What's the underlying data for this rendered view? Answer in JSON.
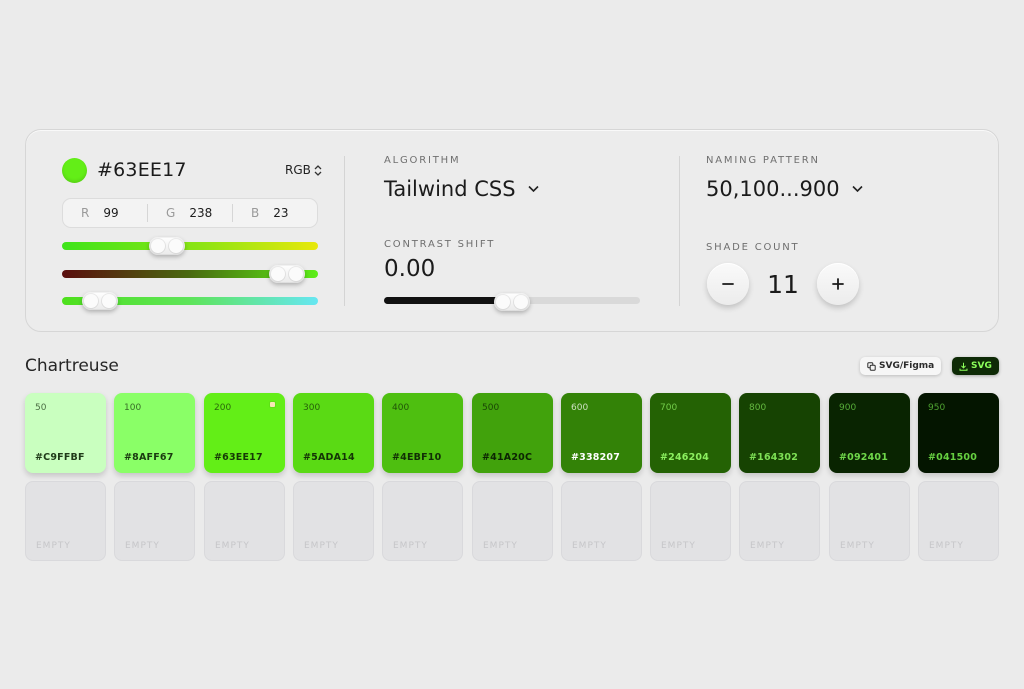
{
  "color_input": {
    "hex": "#63EE17",
    "swatch_color": "#63EE17",
    "mode": "RGB",
    "channels": [
      {
        "label": "R",
        "value": "99"
      },
      {
        "label": "G",
        "value": "238"
      },
      {
        "label": "B",
        "value": "23"
      }
    ],
    "sliders": [
      {
        "name": "hue",
        "value": 0.41
      },
      {
        "name": "saturation",
        "value": 0.88
      },
      {
        "name": "lightness",
        "value": 0.15
      }
    ]
  },
  "algorithm": {
    "label": "ALGORITHM",
    "value": "Tailwind CSS",
    "contrast_label": "CONTRAST SHIFT",
    "contrast_value": "0.00",
    "contrast_position": 0.5
  },
  "naming": {
    "label": "NAMING PATTERN",
    "value": "50,100...900",
    "shade_label": "SHADE COUNT",
    "shade_count": "11"
  },
  "palette": {
    "name": "Chartreuse",
    "export_figma_label": "SVG/Figma",
    "export_svg_label": "SVG",
    "swatches": [
      {
        "step": "50",
        "hex": "#C9FFBF",
        "bg": "#C9FFBF",
        "text": "#1f3a18",
        "base": false
      },
      {
        "step": "100",
        "hex": "#8AFF67",
        "bg": "#8AFF67",
        "text": "#1a3a10",
        "base": false
      },
      {
        "step": "200",
        "hex": "#63EE17",
        "bg": "#63EE17",
        "text": "#163a06",
        "base": true
      },
      {
        "step": "300",
        "hex": "#5ADA14",
        "bg": "#5ADA14",
        "text": "#143406",
        "base": false
      },
      {
        "step": "400",
        "hex": "#4EBF10",
        "bg": "#4EBF10",
        "text": "#112e05",
        "base": false
      },
      {
        "step": "500",
        "hex": "#41A20C",
        "bg": "#41A20C",
        "text": "#0c2403",
        "base": false
      },
      {
        "step": "600",
        "hex": "#338207",
        "bg": "#338207",
        "text": "#ffffff",
        "base": false
      },
      {
        "step": "700",
        "hex": "#246204",
        "bg": "#246204",
        "text": "#8cf060",
        "base": false
      },
      {
        "step": "800",
        "hex": "#164302",
        "bg": "#164302",
        "text": "#7ee055",
        "base": false
      },
      {
        "step": "900",
        "hex": "#092401",
        "bg": "#092401",
        "text": "#6fd84a",
        "base": false
      },
      {
        "step": "950",
        "hex": "#041500",
        "bg": "#041500",
        "text": "#66d040",
        "base": false
      }
    ],
    "empty_label": "EMPTY",
    "empty_count": 11
  },
  "icons": {
    "mode_toggle": "chevron-up-down-icon",
    "dropdown": "chevron-down-icon",
    "minus": "minus-icon",
    "plus": "plus-icon",
    "figma": "copy-icon",
    "download": "download-icon",
    "base_marker": "base-marker-icon"
  }
}
